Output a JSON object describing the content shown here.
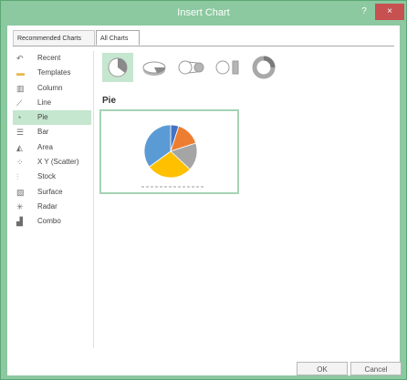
{
  "window": {
    "title": "Insert Chart",
    "help_label": "?",
    "close_label": "×"
  },
  "tabs": [
    {
      "label": "Recommended Charts",
      "active": false
    },
    {
      "label": "All Charts",
      "active": true
    }
  ],
  "categories": [
    {
      "label": "Recent",
      "icon": "recent-icon",
      "selected": false
    },
    {
      "label": "Templates",
      "icon": "templates-folder-icon",
      "selected": false
    },
    {
      "label": "Column",
      "icon": "column-chart-icon",
      "selected": false
    },
    {
      "label": "Line",
      "icon": "line-chart-icon",
      "selected": false
    },
    {
      "label": "Pie",
      "icon": "pie-chart-icon",
      "selected": true
    },
    {
      "label": "Bar",
      "icon": "bar-chart-icon",
      "selected": false
    },
    {
      "label": "Area",
      "icon": "area-chart-icon",
      "selected": false
    },
    {
      "label": "X Y (Scatter)",
      "icon": "scatter-chart-icon",
      "selected": false
    },
    {
      "label": "Stock",
      "icon": "stock-chart-icon",
      "selected": false
    },
    {
      "label": "Surface",
      "icon": "surface-chart-icon",
      "selected": false
    },
    {
      "label": "Radar",
      "icon": "radar-chart-icon",
      "selected": false
    },
    {
      "label": "Combo",
      "icon": "combo-chart-icon",
      "selected": false
    }
  ],
  "subtypes": [
    {
      "icon": "pie-subtype-icon",
      "selected": true
    },
    {
      "icon": "3d-pie-subtype-icon",
      "selected": false
    },
    {
      "icon": "pie-of-pie-subtype-icon",
      "selected": false
    },
    {
      "icon": "bar-of-pie-subtype-icon",
      "selected": false
    },
    {
      "icon": "doughnut-subtype-icon",
      "selected": false
    }
  ],
  "selected_type_name": "Pie",
  "preview": {
    "slice_colors": [
      "#4472c4",
      "#ed7d31",
      "#a5a5a5",
      "#ffc000",
      "#5b9bd5"
    ],
    "slice_fractions": [
      0.05,
      0.15,
      0.17,
      0.28,
      0.35
    ]
  },
  "buttons": {
    "ok_label": "OK",
    "cancel_label": "Cancel"
  },
  "colors": {
    "accent": "#8cc8a0",
    "selection": "#c5e6cf",
    "close_red": "#c75050"
  }
}
